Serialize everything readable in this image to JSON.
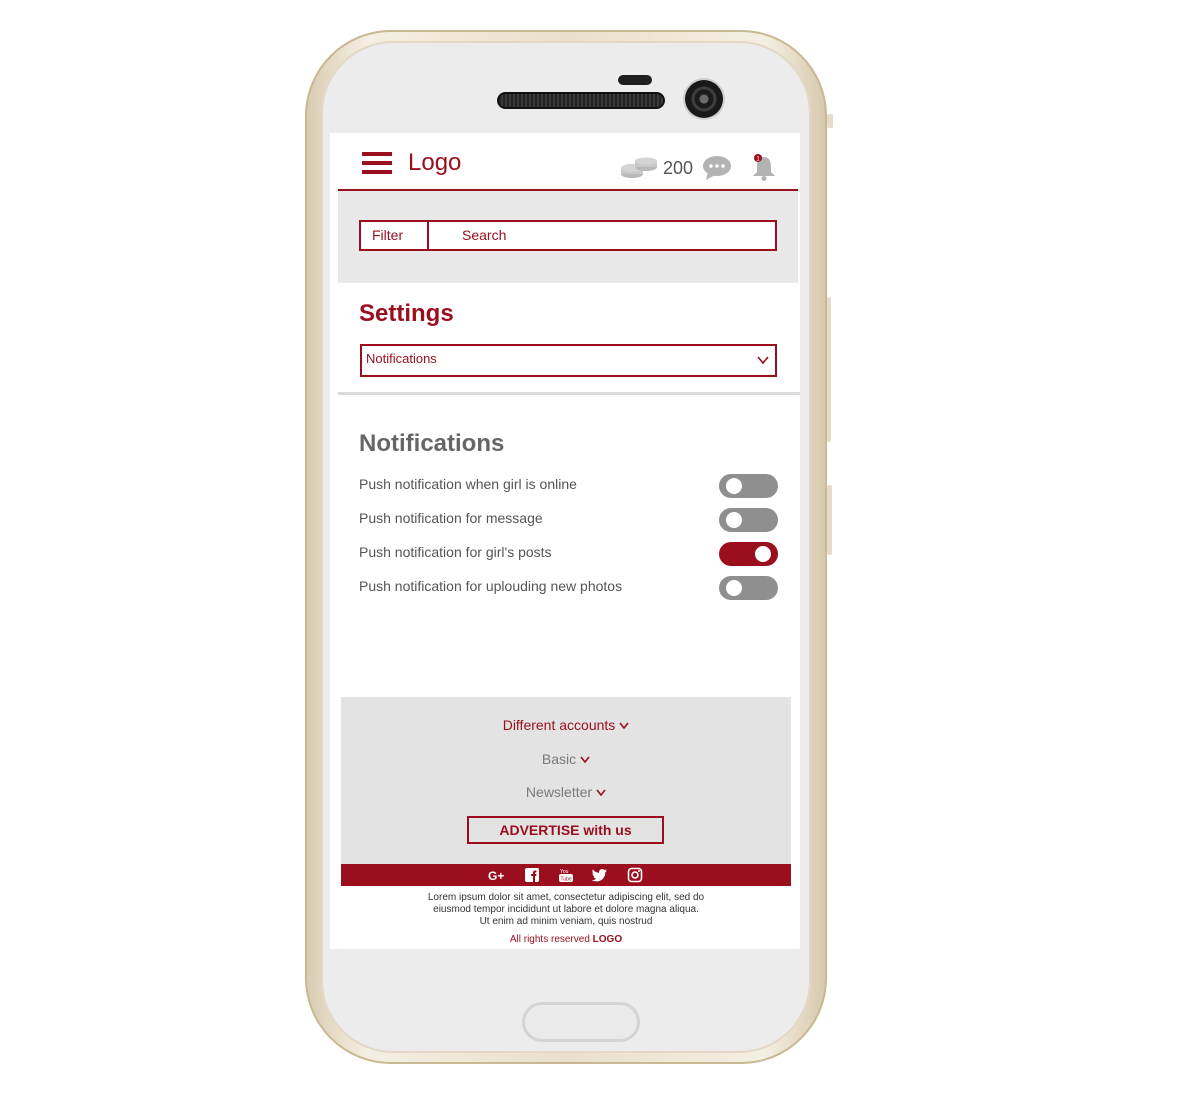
{
  "header": {
    "logo": "Logo",
    "coins": "200",
    "bell_badge": "1"
  },
  "search": {
    "filter_label": "Filter",
    "search_label": "Search"
  },
  "settings": {
    "title": "Settings",
    "selected": "Notifications"
  },
  "notifications": {
    "title": "Notifications",
    "items": [
      {
        "label": "Push notification when girl is online",
        "enabled": false
      },
      {
        "label": "Push notification for message",
        "enabled": false
      },
      {
        "label": "Push notification for girl's posts",
        "enabled": true
      },
      {
        "label": "Push notification for uplouding new photos",
        "enabled": false
      }
    ]
  },
  "footer": {
    "links": [
      "Different accounts",
      "Basic",
      "Newsletter"
    ],
    "advertise": "ADVERTISE with us",
    "social": [
      "google-plus-icon",
      "facebook-icon",
      "youtube-icon",
      "twitter-icon",
      "instagram-icon"
    ],
    "lorem": [
      "Lorem ipsum dolor sit amet, consectetur adipiscing elit, sed do",
      "eiusmod tempor incididunt ut labore et dolore magna aliqua.",
      "Ut enim ad minim veniam, quis nostrud"
    ],
    "rights_prefix": "All rights reserved",
    "rights_brand": "LOGO"
  },
  "colors": {
    "accent": "#9b0e1e",
    "toggle_off": "#8f8f8f",
    "panel_gray": "#e3e3e3"
  }
}
